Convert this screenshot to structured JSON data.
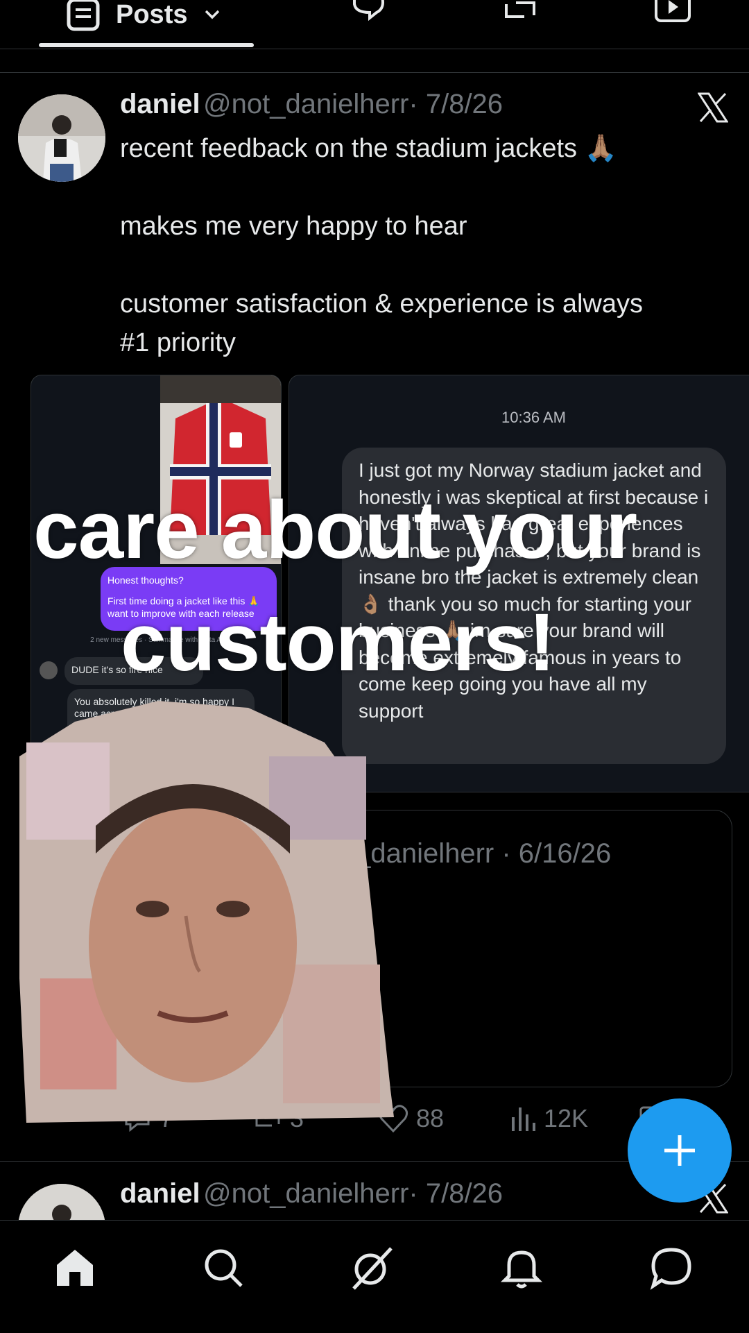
{
  "tabs": {
    "posts_label": "Posts"
  },
  "post1": {
    "name": "daniel",
    "handle": "@not_danielherr",
    "date": "· 7/8/26",
    "text": "recent feedback on the stadium jackets 🙏🏽\n\nmakes me very happy to hear\n\ncustomer satisfaction & experience is always\n#1 priority"
  },
  "media_right": {
    "time": "10:36 AM",
    "message": "I just got my Norway stadium jacket and honestly i was skeptical at first because i haven't always had great experiences with online purchases, but your brand is insane bro the jacket is extremely clean 👌🏽 thank you so much for starting your business 🙏🏽 im sure your brand will become extremely famous in years to come keep going you have all my support"
  },
  "media_left": {
    "purple_title": "Honest thoughts?",
    "purple_body": "First time doing a jacket like this 🙏 want to improve with each release",
    "new_messages": "2 new messages · Summarize with Meta AI",
    "reply1": "DUDE it's so fire nice",
    "reply2": "You absolutely killed it, i'm so happy I came across your page... jacket a few weeks on sale and... caus..."
  },
  "caption": {
    "line1": "care about your",
    "line2": "customers!"
  },
  "quoted": {
    "handle_date": "t_danielherr · 6/16/26"
  },
  "stats": {
    "replies": "7",
    "reposts": "3",
    "likes": "88",
    "views": "12K"
  },
  "post2": {
    "name": "daniel",
    "handle": "@not_danielherr",
    "date": "· 7/8/26"
  },
  "colors": {
    "accent": "#1d9bf0",
    "background": "#000000",
    "muted": "#71767b"
  }
}
